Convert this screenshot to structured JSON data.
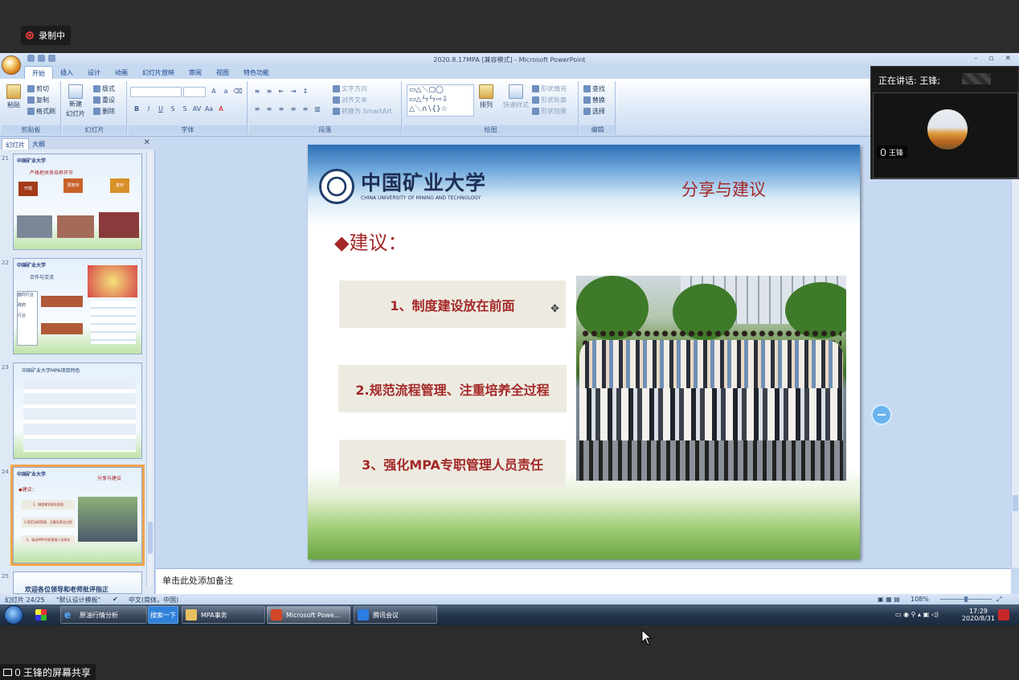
{
  "recording": {
    "label": "录制中"
  },
  "ppt": {
    "window_title": "2020.8.17MPA [兼容模式] - Microsoft PowerPoint",
    "tabs": [
      "开始",
      "插入",
      "设计",
      "动画",
      "幻灯片放映",
      "审阅",
      "视图",
      "特色功能"
    ],
    "active_tab": "开始",
    "ribbon": {
      "clipboard": {
        "label": "剪贴板",
        "paste": "粘贴",
        "cut": "剪切",
        "copy": "复制",
        "format_painter": "格式刷"
      },
      "slides": {
        "label": "幻灯片",
        "new_slide": "新建",
        "new_slide2": "幻灯片",
        "layout": "版式",
        "reset": "重设",
        "delete": "删除"
      },
      "font": {
        "label": "字体"
      },
      "paragraph": {
        "label": "段落",
        "text_direction": "文字方向",
        "align_text": "对齐文本",
        "smartart": "转换为 SmartArt"
      },
      "drawing": {
        "label": "绘图",
        "arrange": "排列",
        "quick_styles": "快速样式",
        "shape_fill": "形状填充",
        "shape_outline": "形状轮廓",
        "shape_effects": "形状效果"
      },
      "editing": {
        "label": "编辑",
        "find": "查找",
        "replace": "替换",
        "select": "选择"
      }
    },
    "pane_tabs": {
      "slides": "幻灯片",
      "outline": "大纲"
    },
    "thumbnails": [
      {
        "num": "21",
        "title": "严格把关各培养环节",
        "boxes": [
          "开题",
          "预答辩",
          "答辩"
        ]
      },
      {
        "num": "22",
        "title": "合作与交流",
        "boxes": [
          "面向行业",
          "政府",
          "行业"
        ]
      },
      {
        "num": "23",
        "title": "中国矿业大学MPA项目特色"
      },
      {
        "num": "24",
        "title": "分享与建议"
      },
      {
        "num": "25",
        "title": "欢迎各位领导和老师批评指正"
      }
    ],
    "slide": {
      "logo_cn": "中国矿业大学",
      "logo_en": "CHINA UNIVERSITY OF MINING AND TECHNOLOGY",
      "title": "分享与建议",
      "subtitle": "◆建议：",
      "points": [
        "1、制度建设放在前面",
        "2.规范流程管理、注重培养全过程",
        "3、强化MPA专职管理人员责任"
      ]
    },
    "notes_placeholder": "单击此处添加备注",
    "status": {
      "slide_pos": "幻灯片 24/25",
      "theme": "\"默认设计模板\"",
      "lang": "中文(简体，中国)",
      "zoom": "108%"
    }
  },
  "taskbar": {
    "items": [
      {
        "label": "原油行情分析",
        "icon": "ie-icon"
      },
      {
        "label": "搜索一下",
        "icon": ""
      },
      {
        "label": "MPA事务",
        "icon": "folder-icon"
      },
      {
        "label": "Microsoft Powe...",
        "icon": "ppt-icon"
      },
      {
        "label": "腾讯会议",
        "icon": "meeting-icon"
      }
    ],
    "time": "17:29",
    "date": "2020/8/31"
  },
  "call": {
    "speaking": "正在讲话: 王锋;",
    "participant": "王锋",
    "share_label": "王锋的屏幕共享"
  }
}
